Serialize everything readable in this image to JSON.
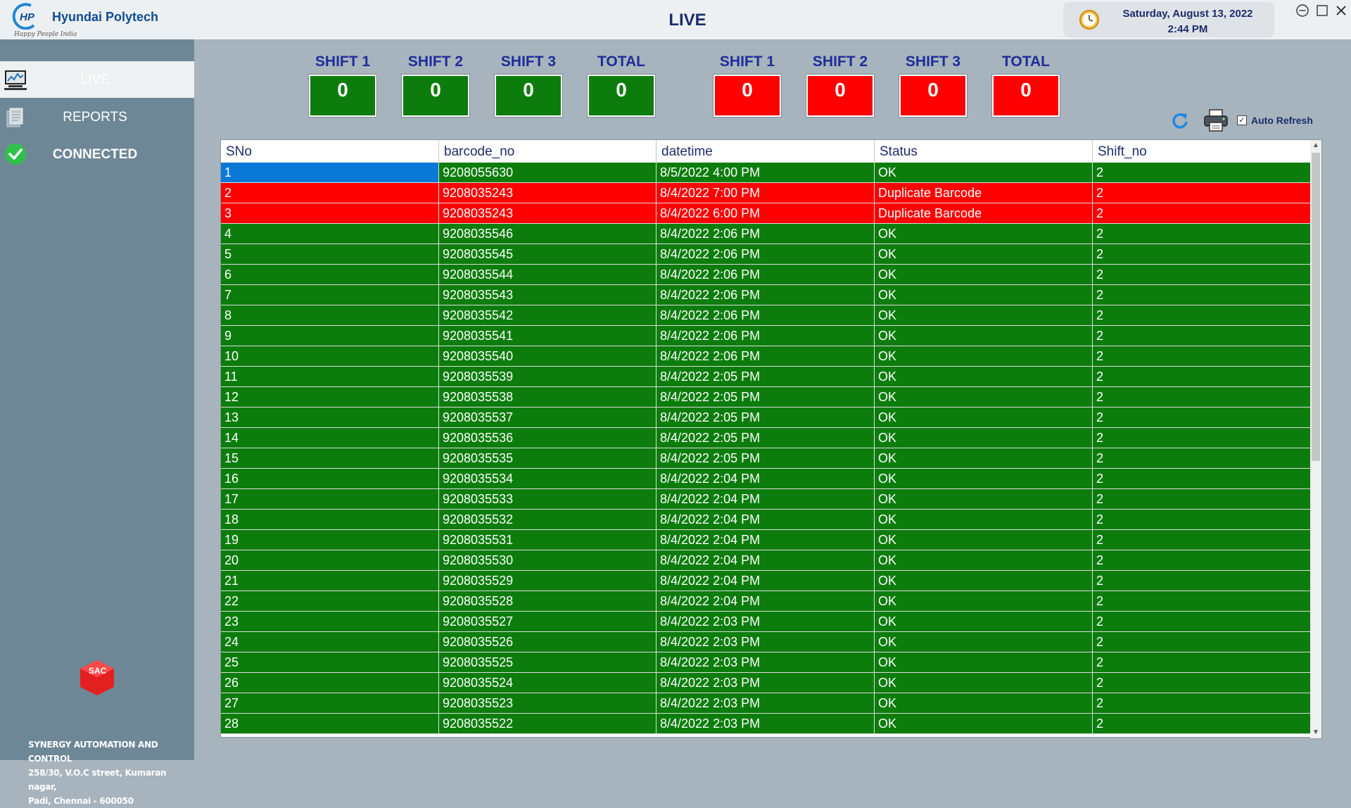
{
  "app": {
    "company_name": "Hyundai Polytech",
    "logo_mark": "HP",
    "tagline": "Happy People India",
    "page_title": "LIVE"
  },
  "datetime": {
    "date": "Saturday, August 13, 2022",
    "time": "2:44 PM"
  },
  "window_controls": [
    "minimize-icon",
    "maximize-icon",
    "close-icon"
  ],
  "sidebar": {
    "items": [
      {
        "label": "LIVE",
        "icon": "monitor-icon",
        "active": true
      },
      {
        "label": "REPORTS",
        "icon": "documents-icon",
        "active": false
      },
      {
        "label": "CONNECTED",
        "icon": "check-circle-icon",
        "active": false
      }
    ],
    "company_logo_text": "SAC",
    "company_lines": [
      "SYNERGY AUTOMATION AND CONTROL",
      "258/30, V.O.C street, Kumaran nagar,",
      "Padi, Chennai - 600050"
    ]
  },
  "counters": {
    "ok": [
      {
        "label": "SHIFT 1",
        "value": "0"
      },
      {
        "label": "SHIFT 2",
        "value": "0"
      },
      {
        "label": "SHIFT 3",
        "value": "0"
      },
      {
        "label": "TOTAL",
        "value": "0"
      }
    ],
    "ng": [
      {
        "label": "SHIFT 1",
        "value": "0"
      },
      {
        "label": "SHIFT 2",
        "value": "0"
      },
      {
        "label": "SHIFT 3",
        "value": "0"
      },
      {
        "label": "TOTAL",
        "value": "0"
      }
    ]
  },
  "toolbar": {
    "auto_refresh_label": "Auto Refresh",
    "auto_refresh_checked": true
  },
  "colors": {
    "ok_green": "#0c7d0c",
    "ng_red": "#ff0000",
    "selected_blue": "#0a78d6"
  },
  "grid": {
    "columns": [
      "SNo",
      "barcode_no",
      "datetime",
      "Status",
      "Shift_no"
    ],
    "rows": [
      {
        "sno": "1",
        "barcode": "9208055630",
        "datetime": "8/5/2022 4:00 PM",
        "status": "OK",
        "shift": "2"
      },
      {
        "sno": "2",
        "barcode": "9208035243",
        "datetime": "8/4/2022 7:00 PM",
        "status": "Duplicate Barcode",
        "shift": "2"
      },
      {
        "sno": "3",
        "barcode": "9208035243",
        "datetime": "8/4/2022 6:00 PM",
        "status": "Duplicate Barcode",
        "shift": "2"
      },
      {
        "sno": "4",
        "barcode": "9208035546",
        "datetime": "8/4/2022 2:06 PM",
        "status": "OK",
        "shift": "2"
      },
      {
        "sno": "5",
        "barcode": "9208035545",
        "datetime": "8/4/2022 2:06 PM",
        "status": "OK",
        "shift": "2"
      },
      {
        "sno": "6",
        "barcode": "9208035544",
        "datetime": "8/4/2022 2:06 PM",
        "status": "OK",
        "shift": "2"
      },
      {
        "sno": "7",
        "barcode": "9208035543",
        "datetime": "8/4/2022 2:06 PM",
        "status": "OK",
        "shift": "2"
      },
      {
        "sno": "8",
        "barcode": "9208035542",
        "datetime": "8/4/2022 2:06 PM",
        "status": "OK",
        "shift": "2"
      },
      {
        "sno": "9",
        "barcode": "9208035541",
        "datetime": "8/4/2022 2:06 PM",
        "status": "OK",
        "shift": "2"
      },
      {
        "sno": "10",
        "barcode": "9208035540",
        "datetime": "8/4/2022 2:06 PM",
        "status": "OK",
        "shift": "2"
      },
      {
        "sno": "11",
        "barcode": "9208035539",
        "datetime": "8/4/2022 2:05 PM",
        "status": "OK",
        "shift": "2"
      },
      {
        "sno": "12",
        "barcode": "9208035538",
        "datetime": "8/4/2022 2:05 PM",
        "status": "OK",
        "shift": "2"
      },
      {
        "sno": "13",
        "barcode": "9208035537",
        "datetime": "8/4/2022 2:05 PM",
        "status": "OK",
        "shift": "2"
      },
      {
        "sno": "14",
        "barcode": "9208035536",
        "datetime": "8/4/2022 2:05 PM",
        "status": "OK",
        "shift": "2"
      },
      {
        "sno": "15",
        "barcode": "9208035535",
        "datetime": "8/4/2022 2:05 PM",
        "status": "OK",
        "shift": "2"
      },
      {
        "sno": "16",
        "barcode": "9208035534",
        "datetime": "8/4/2022 2:04 PM",
        "status": "OK",
        "shift": "2"
      },
      {
        "sno": "17",
        "barcode": "9208035533",
        "datetime": "8/4/2022 2:04 PM",
        "status": "OK",
        "shift": "2"
      },
      {
        "sno": "18",
        "barcode": "9208035532",
        "datetime": "8/4/2022 2:04 PM",
        "status": "OK",
        "shift": "2"
      },
      {
        "sno": "19",
        "barcode": "9208035531",
        "datetime": "8/4/2022 2:04 PM",
        "status": "OK",
        "shift": "2"
      },
      {
        "sno": "20",
        "barcode": "9208035530",
        "datetime": "8/4/2022 2:04 PM",
        "status": "OK",
        "shift": "2"
      },
      {
        "sno": "21",
        "barcode": "9208035529",
        "datetime": "8/4/2022 2:04 PM",
        "status": "OK",
        "shift": "2"
      },
      {
        "sno": "22",
        "barcode": "9208035528",
        "datetime": "8/4/2022 2:04 PM",
        "status": "OK",
        "shift": "2"
      },
      {
        "sno": "23",
        "barcode": "9208035527",
        "datetime": "8/4/2022 2:03 PM",
        "status": "OK",
        "shift": "2"
      },
      {
        "sno": "24",
        "barcode": "9208035526",
        "datetime": "8/4/2022 2:03 PM",
        "status": "OK",
        "shift": "2"
      },
      {
        "sno": "25",
        "barcode": "9208035525",
        "datetime": "8/4/2022 2:03 PM",
        "status": "OK",
        "shift": "2"
      },
      {
        "sno": "26",
        "barcode": "9208035524",
        "datetime": "8/4/2022 2:03 PM",
        "status": "OK",
        "shift": "2"
      },
      {
        "sno": "27",
        "barcode": "9208035523",
        "datetime": "8/4/2022 2:03 PM",
        "status": "OK",
        "shift": "2"
      },
      {
        "sno": "28",
        "barcode": "9208035522",
        "datetime": "8/4/2022 2:03 PM",
        "status": "OK",
        "shift": "2"
      }
    ]
  }
}
